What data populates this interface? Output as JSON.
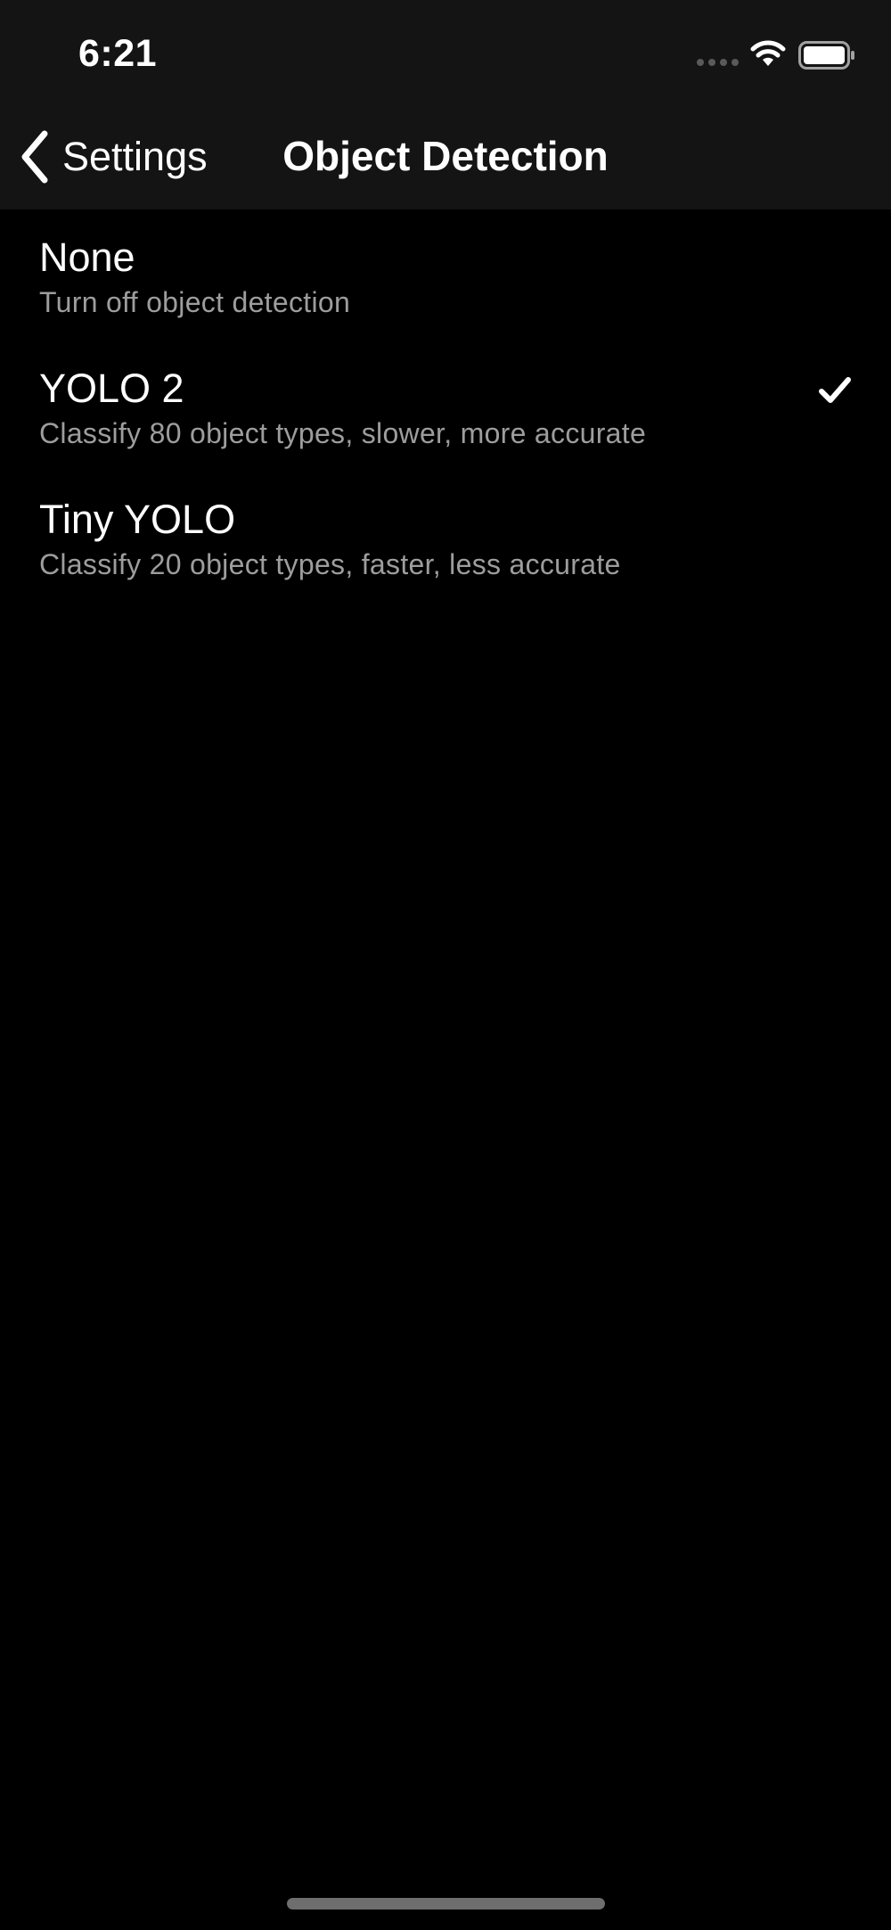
{
  "status_bar": {
    "time": "6:21",
    "icons": [
      "signal-dots-icon",
      "wifi-icon",
      "battery-icon"
    ]
  },
  "nav": {
    "back_label": "Settings",
    "title": "Object Detection"
  },
  "options": [
    {
      "title": "None",
      "subtitle": "Turn off object detection",
      "selected": false
    },
    {
      "title": "YOLO 2",
      "subtitle": "Classify 80 object types, slower, more accurate",
      "selected": true
    },
    {
      "title": "Tiny YOLO",
      "subtitle": "Classify 20 object types, faster, less accurate",
      "selected": false
    }
  ],
  "colors": {
    "background": "#000000",
    "header_background": "#141414",
    "primary_text": "#ffffff",
    "secondary_text": "#9d9d9d",
    "home_indicator": "#6e6e6e"
  }
}
